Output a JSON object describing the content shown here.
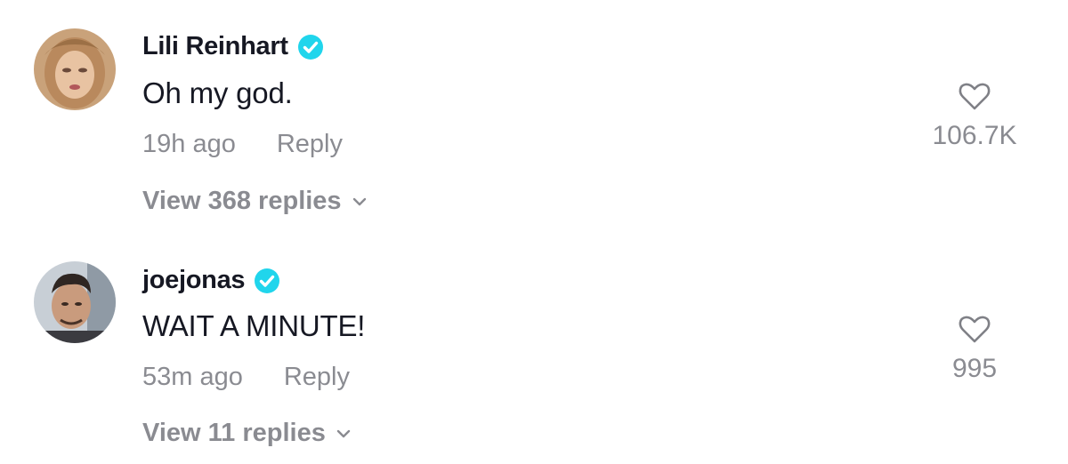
{
  "comments": [
    {
      "username": "Lili Reinhart",
      "verified": true,
      "text": "Oh my god.",
      "time": "19h ago",
      "reply_label": "Reply",
      "view_replies": "View 368 replies",
      "likes": "106.7K",
      "avatar_icon": "avatar-lili-reinhart"
    },
    {
      "username": "joejonas",
      "verified": true,
      "text": "WAIT A MINUTE!",
      "time": "53m ago",
      "reply_label": "Reply",
      "view_replies": "View 11 replies",
      "likes": "995",
      "avatar_icon": "avatar-joejonas"
    }
  ],
  "colors": {
    "verified_badge": "#20d5ec",
    "primary_text": "#161823",
    "secondary_text": "rgba(22,24,35,0.5)"
  }
}
